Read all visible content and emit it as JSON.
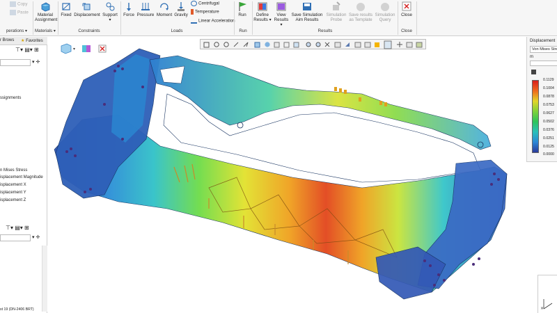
{
  "ribbon": {
    "clipboard": {
      "copy": "Copy",
      "paste": "Paste"
    },
    "operations_group": "perations",
    "material": {
      "button": "Material Assignment",
      "group": "Materials"
    },
    "constraints": {
      "fixed": "Fixed",
      "displacement": "Displacement",
      "support": "Support",
      "group": "Constraints"
    },
    "loads": {
      "force": "Force",
      "pressure": "Pressure",
      "moment": "Moment",
      "gravity": "Gravity",
      "centrifugal": "Centrifugal",
      "temperature": "Temperature",
      "linear_acceleration": "Linear Acceleration",
      "group": "Loads"
    },
    "run": {
      "button": "Run",
      "group": "Run"
    },
    "results": {
      "define": "Define Results",
      "view": "View Results",
      "save_aim": "Save Simulation Aim Results",
      "probe": "Simulation Probe",
      "save_template": "Save results as Template",
      "query": "Simulation Query",
      "group": "Results"
    },
    "close": {
      "button": "Close",
      "group": "Close"
    }
  },
  "left_panel": {
    "tab_browser": "r Brows",
    "tab_favorites": "Favorites",
    "tree_items": [
      "ssignments",
      "n Mises Stress",
      "isplacement Magnitude",
      "isplacement X",
      "isplacement Y",
      "isplacement Z"
    ],
    "status_text": "st 19 (DN-2406 BRT)"
  },
  "legend": {
    "title": "Displacement",
    "quantity": "Von Mises Stress",
    "unit": "m",
    "values": [
      "0.1129",
      "0.1004",
      "0.0878",
      "0.0753",
      "0.0627",
      "0.0502",
      "0.0376",
      "0.0251",
      "0.0125",
      "0.0000"
    ]
  },
  "colors": {
    "accent": "#1e5fa8",
    "max": "#d81e1e",
    "min": "#2a3a9a"
  }
}
